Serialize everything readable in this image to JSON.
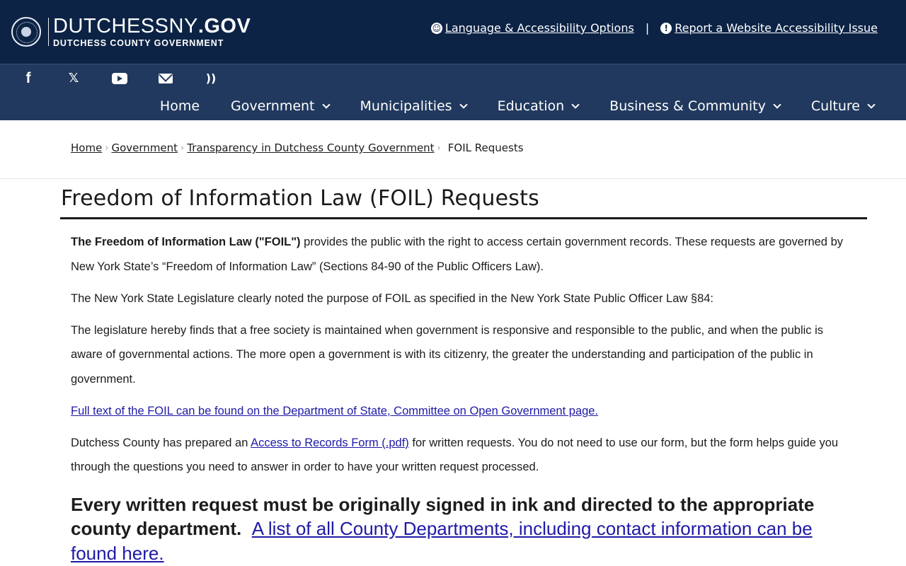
{
  "header": {
    "logo_main_a": "DUTCHESSNY",
    "logo_main_b": ".GOV",
    "logo_sub": "DUTCHESS COUNTY GOVERNMENT",
    "links": {
      "language": "Language & Accessibility Options",
      "separator": "|",
      "report": "Report a Website Accessibility Issue"
    }
  },
  "social": {
    "icons": [
      "facebook-icon",
      "x-icon",
      "youtube-icon",
      "email-icon",
      "rss-icon"
    ],
    "facebook_glyph": "f",
    "x_glyph": "𝕏",
    "rss_glyph": "))"
  },
  "nav": {
    "home": "Home",
    "government": "Government",
    "municipalities": "Municipalities",
    "education": "Education",
    "business": "Business & Community",
    "culture": "Culture"
  },
  "breadcrumb": {
    "home": "Home",
    "government": "Government",
    "transparency": "Transparency in Dutchess County Government",
    "current": "FOIL Requests",
    "sep": "›"
  },
  "page": {
    "title": "Freedom of Information Law (FOIL) Requests",
    "p1_bold": "The Freedom of Information Law (\"FOIL\")",
    "p1_rest": " provides the public with the right to access certain government records. These requests are governed by New York State’s “Freedom of Information Law” (Sections 84-90 of the Public Officers Law).",
    "p2": "The New York State Legislature clearly noted the purpose of FOIL as specified in the New York State Public Officer Law §84:",
    "p3": "The legislature hereby finds that a free society is maintained when government is responsive and responsible to the public, and when the public is aware of governmental actions. The more open a government is with its citizenry, the greater the understanding and participation of the public in government.",
    "p4_link": "Full text of the FOIL can be found on the Department of State, Committee on Open Government page.",
    "p5_pre": "Dutchess County has prepared an ",
    "p5_link": "Access to Records Form (.pdf)",
    "p5_post": " for written requests. You do not need to use our form, but the form helps guide you through the questions you need to answer in order to have your written request processed.",
    "big_bold": "Every written request must be originally signed in ink and directed to the appropriate county department.",
    "big_link": "A list of all County Departments, including contact information can be found here."
  },
  "colors": {
    "header_bg": "#0c2345",
    "nav_bg": "#21395e",
    "link": "#1f1aa5"
  }
}
